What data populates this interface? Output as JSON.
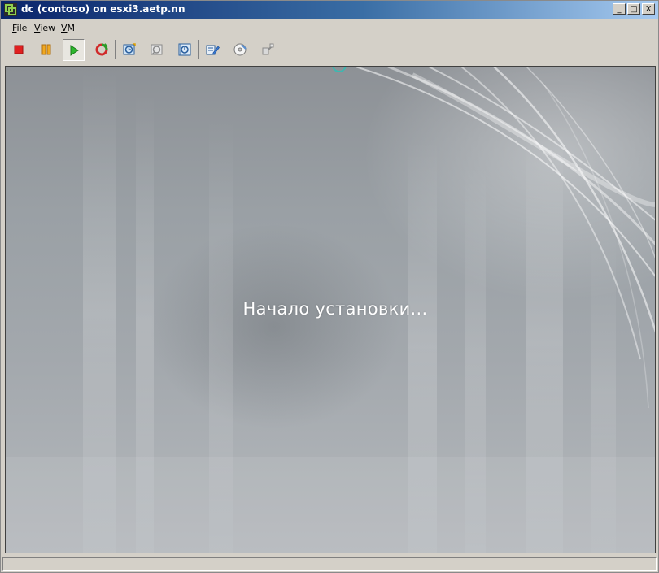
{
  "window": {
    "title": "dc (contoso) on esxi3.aetp.nn",
    "controls": {
      "minimize": "_",
      "maximize": "□",
      "close": "X"
    }
  },
  "menu": {
    "items": [
      {
        "label_first": "F",
        "label_rest": "ile"
      },
      {
        "label_first": "V",
        "label_rest": "iew"
      },
      {
        "label_first": "V",
        "label_rest": "M"
      }
    ]
  },
  "toolbar": {
    "buttons": [
      {
        "icon": "stop-icon",
        "color": "#e02020"
      },
      {
        "icon": "pause-icon",
        "color": "#e8a020"
      },
      {
        "icon": "play-icon",
        "color": "#2a9d2a",
        "active": true
      },
      {
        "icon": "reset-icon",
        "color": "#cc2a2a"
      },
      {
        "icon": "snapshot-icon"
      },
      {
        "icon": "revert-snapshot-icon"
      },
      {
        "icon": "snapshot-manager-icon"
      },
      {
        "icon": "edit-settings-icon"
      },
      {
        "icon": "cd-drive-icon"
      },
      {
        "icon": "connect-device-icon"
      }
    ]
  },
  "console": {
    "message": "Начало установки..."
  }
}
